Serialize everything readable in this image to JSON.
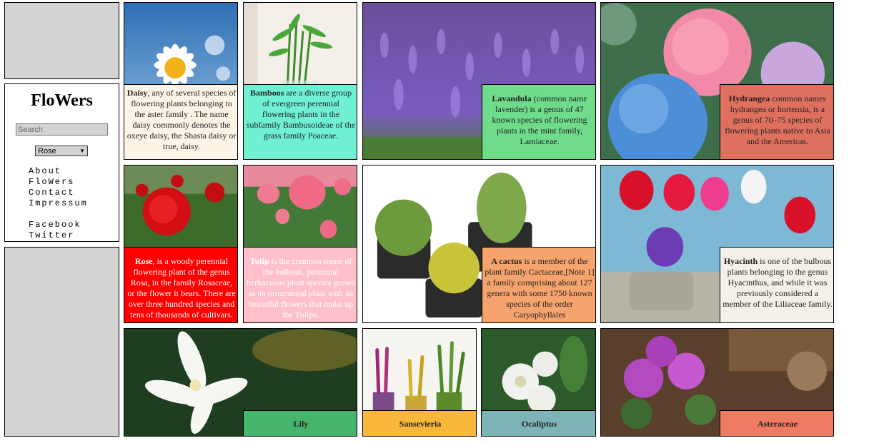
{
  "sidebar": {
    "brand": "FloWers",
    "search_placeholder": "Search",
    "select_value": "Rose",
    "nav": [
      "About",
      "FloWers",
      "Contact",
      "Impressum"
    ],
    "social": [
      "Facebook",
      "Twitter"
    ]
  },
  "tiles": {
    "daisy": {
      "name": "Daisy",
      "text": ", any of several species of flowering plants belonging to the aster family . The name daisy commonly denotes the oxeye daisy, the Shasta daisy or true, daisy."
    },
    "bamboo": {
      "name": "Bamboos",
      "text": " are a diverse group of evergreen perennial flowering plants in the subfamily Bambusoideae of the grass family Poaceae."
    },
    "lavandula": {
      "name": "Lavandula",
      "text": " (common name lavender) is a genus of 47 known species of flowering plants in the mint family, Lamiaceae."
    },
    "hydrangea": {
      "name": "Hydrangea",
      "text": " common names hydrangea or hortensia, is a genus of 70–75 species of flowering plants native to Asia and the Americas."
    },
    "rose": {
      "name": "Rose",
      "text": ", is a woody perennial flowering plant of the genus Rosa, in the family Rosaceae, or the flower it bears. There are over three hundred species and tens of thousands of cultivars."
    },
    "tulip": {
      "name": "Tulip",
      "text": " is the common name of the bulbous, perennial herbaceous plant species grown as an ornamental plant with its beautiful flowers that make up the Tulipa."
    },
    "cactus": {
      "name": "A cactus",
      "text": " is a member of the plant family Cactaceae,[Note 1] a family comprising about 127 genera with some 1750 known species of the order Caryophyllales"
    },
    "hyacinth": {
      "name": "Hyacinth",
      "text": " is one of the bulbous plants belonging to the genus Hyacinthus, and while it was previously considered a member of the Liliaceae family."
    },
    "lily": {
      "name": "Lily"
    },
    "sansevieria": {
      "name": "Sansevieria"
    },
    "ocaliptus": {
      "name": "Ocaliptus"
    },
    "asteraceae": {
      "name": "Asteraceae"
    }
  },
  "colors": {
    "panel_gray": "#d3d3d3",
    "daisy_cap": "#fdf3e7",
    "bamboo_cap": "#6ff0d2",
    "lavandula_cap": "#6fdc8c",
    "hydrangea_cap": "#e0705e",
    "rose_cap": "#ff0000",
    "tulip_cap": "#ffc0cb",
    "cactus_cap": "#f6a36d",
    "hyacinth_cap": "#f4f0e8",
    "lily_cap": "#44b56a",
    "sansevieria_cap": "#f8b73a",
    "ocaliptus_cap": "#7cb4b8",
    "asteraceae_cap": "#f07b63"
  }
}
